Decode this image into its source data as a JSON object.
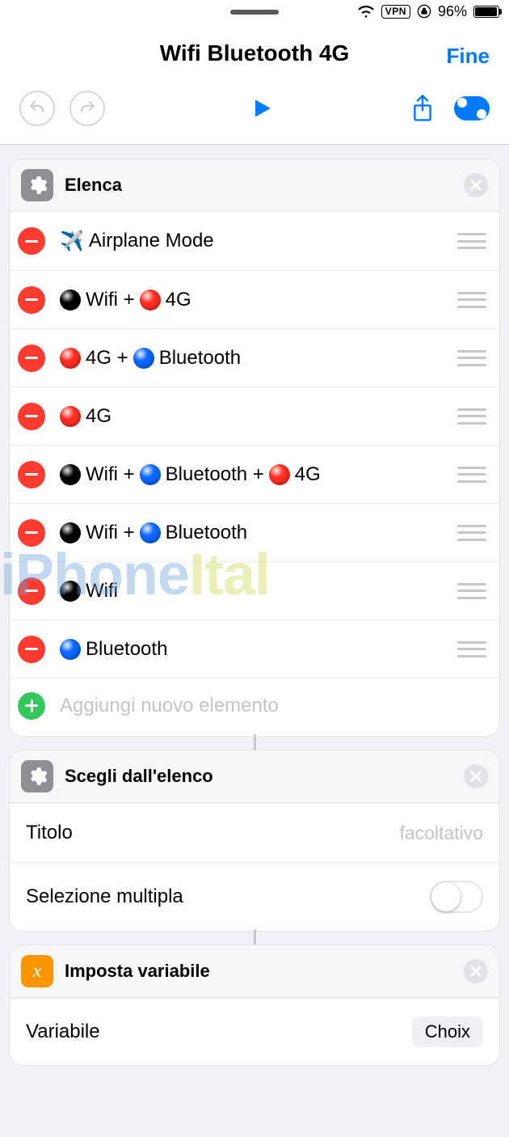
{
  "status": {
    "vpn": "VPN",
    "battery_text": "96%"
  },
  "nav": {
    "title": "Wifi Bluetooth 4G",
    "done": "Fine"
  },
  "cards": {
    "list": {
      "title": "Elenca",
      "items": [
        "✈️ Airplane Mode",
        "⚫ Wifi + 🔴 4G",
        "🔴 4G + 🔵 Bluetooth",
        "🔴 4G",
        "⚫ Wifi + 🔵 Bluetooth + 🔴 4G",
        "⚫ Wifi + 🔵 Bluetooth",
        "⚫ Wifi",
        "🔵 Bluetooth"
      ],
      "add_label": "Aggiungi nuovo elemento"
    },
    "choose": {
      "title": "Scegli dall'elenco",
      "title_field_label": "Titolo",
      "title_field_placeholder": "facoltativo",
      "multi_label": "Selezione multipla"
    },
    "setvar": {
      "title": "Imposta variabile",
      "field_label": "Variabile",
      "field_value": "Choix"
    }
  },
  "watermark": {
    "a": "iPhone",
    "b": "Ital"
  }
}
